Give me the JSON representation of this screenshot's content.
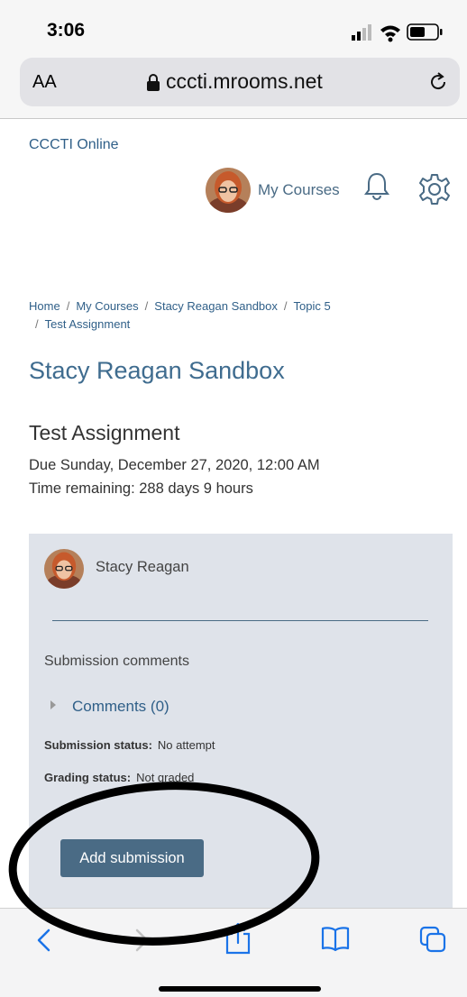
{
  "status_bar": {
    "time": "3:06"
  },
  "browser": {
    "text_size_label": "AA",
    "domain": "cccti.mrooms.net"
  },
  "header": {
    "site_name": "CCCTI Online",
    "my_courses_label": "My Courses"
  },
  "breadcrumb": {
    "items": [
      "Home",
      "My Courses",
      "Stacy Reagan Sandbox",
      "Topic 5",
      "Test Assignment"
    ],
    "separator": "/"
  },
  "page": {
    "course_title": "Stacy Reagan Sandbox",
    "assignment_title": "Test Assignment",
    "due": "Due Sunday, December 27, 2020, 12:00 AM",
    "time_remaining": "Time remaining: 288 days 9 hours"
  },
  "submission": {
    "student_name": "Stacy Reagan",
    "comments_heading": "Submission comments",
    "comments_toggle": "Comments (0)",
    "status_label": "Submission status:",
    "status_value": "No attempt",
    "grading_label": "Grading status:",
    "grading_value": "Not graded",
    "add_button": "Add submission"
  },
  "colors": {
    "link_blue": "#2f5f88",
    "panel_bg": "#dfe3ea",
    "button_bg": "#4a6b85",
    "ios_blue": "#1a73e8"
  },
  "toolbar": {
    "icons": [
      "back-icon",
      "forward-icon",
      "share-icon",
      "bookmarks-icon",
      "tabs-icon"
    ]
  }
}
